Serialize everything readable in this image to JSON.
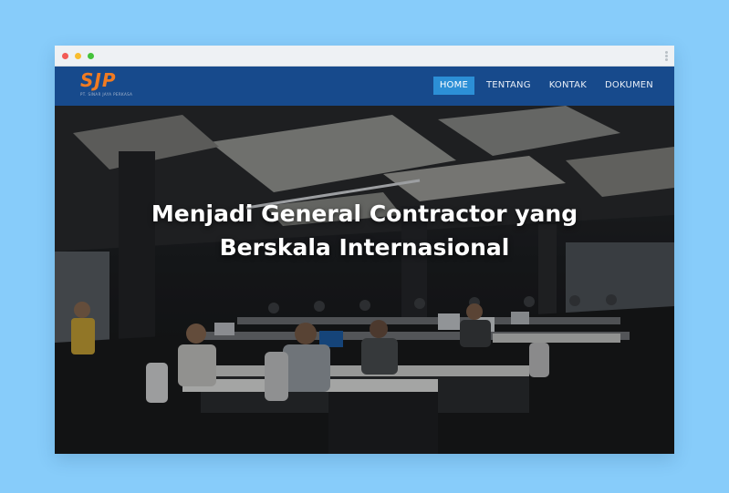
{
  "browser": {
    "traffic_lights": [
      "#f25a55",
      "#f8bd2f",
      "#44c23b"
    ],
    "menu_icon": "kebab-icon"
  },
  "brand": {
    "logo_text": "SJP",
    "logo_subtitle": "PT. SINAR JAYA PERKASA",
    "logo_color": "#f07b22"
  },
  "nav": {
    "background": "#174a8c",
    "active_color": "#2c8fd6",
    "items": [
      {
        "label": "HOME",
        "active": true
      },
      {
        "label": "TENTANG",
        "active": false
      },
      {
        "label": "KONTAK",
        "active": false
      },
      {
        "label": "DOKUMEN",
        "active": false
      }
    ]
  },
  "hero": {
    "title_line1": "Menjadi General Contractor yang",
    "title_line2": "Berskala Internasional"
  }
}
